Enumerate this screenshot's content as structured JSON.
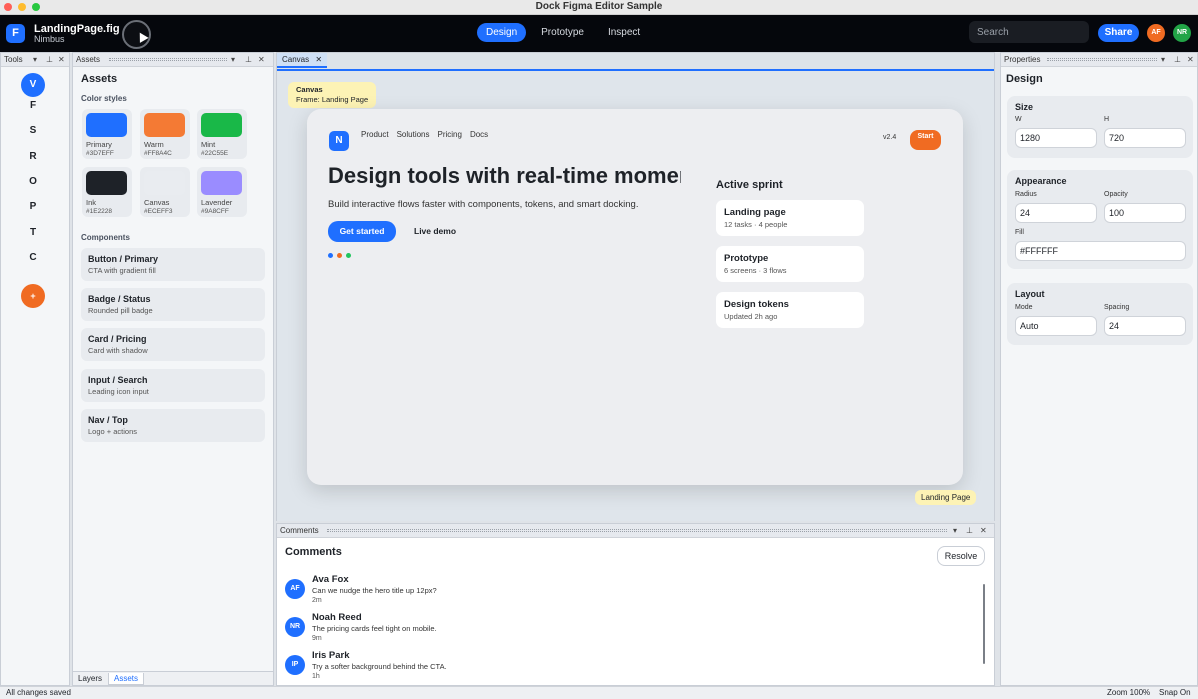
{
  "window": {
    "title": "Dock Figma Editor Sample"
  },
  "app": {
    "logo_letter": "F",
    "file_name": "LandingPage.fig",
    "team": "Nimbus",
    "modes": [
      "Design",
      "Prototype",
      "Inspect"
    ],
    "active_mode": "Design",
    "search_placeholder": "Search",
    "share_label": "Share",
    "avatars": [
      {
        "initials": "AF",
        "color": "#F06B22"
      },
      {
        "initials": "NR",
        "color": "#22A447"
      }
    ]
  },
  "tools_panel": {
    "title": "Tools",
    "tools": [
      "V",
      "F",
      "S",
      "R",
      "O",
      "P",
      "T",
      "C"
    ],
    "active_tool": "V",
    "add_label": "+"
  },
  "assets_panel": {
    "tab_title": "Assets",
    "heading": "Assets",
    "color_styles_label": "Color styles",
    "colors": [
      {
        "name": "Primary",
        "hex": "#3D7EFF"
      },
      {
        "name": "Warm",
        "hex": "#FF8A4C"
      },
      {
        "name": "Mint",
        "hex": "#22C55E"
      },
      {
        "name": "Ink",
        "hex": "#1E2228"
      },
      {
        "name": "Canvas",
        "hex": "#ECEFF3"
      },
      {
        "name": "Lavender",
        "hex": "#9A8CFF"
      }
    ],
    "components_label": "Components",
    "components": [
      {
        "name": "Button / Primary",
        "desc": "CTA with gradient fill"
      },
      {
        "name": "Badge / Status",
        "desc": "Rounded pill badge"
      },
      {
        "name": "Card / Pricing",
        "desc": "Card with shadow"
      },
      {
        "name": "Input / Search",
        "desc": "Leading icon input"
      },
      {
        "name": "Nav / Top",
        "desc": "Logo + actions"
      }
    ],
    "bottom_tabs": [
      "Layers",
      "Assets"
    ],
    "active_bottom_tab": "Assets"
  },
  "canvas": {
    "tab_label": "Canvas",
    "tag_title": "Canvas",
    "tag_subtitle": "Frame: Landing Page",
    "frame": {
      "logo_letter": "N",
      "nav": [
        "Product",
        "Solutions",
        "Pricing",
        "Docs"
      ],
      "version": "v2.4",
      "start_label": "Start",
      "hero_title": "Design tools with real-time momentum",
      "hero_subtitle": "Build interactive flows faster with components, tokens, and smart docking.",
      "primary_cta": "Get started",
      "secondary_cta": "Live demo",
      "dot_colors": [
        "#1F6FFF",
        "#F06B22",
        "#22C55E"
      ],
      "sprint_title": "Active sprint",
      "sprint_items": [
        {
          "name": "Landing page",
          "meta": "12 tasks · 4 people"
        },
        {
          "name": "Prototype",
          "meta": "6 screens · 3 flows"
        },
        {
          "name": "Design tokens",
          "meta": "Updated 2h ago"
        }
      ]
    },
    "frame_label": "Landing Page"
  },
  "comments_panel": {
    "tab_title": "Comments",
    "heading": "Comments",
    "resolve_label": "Resolve",
    "items": [
      {
        "initials": "AF",
        "name": "Ava Fox",
        "text": "Can we nudge the hero title up 12px?",
        "time": "2m"
      },
      {
        "initials": "NR",
        "name": "Noah Reed",
        "text": "The pricing cards feel tight on mobile.",
        "time": "9m"
      },
      {
        "initials": "IP",
        "name": "Iris Park",
        "text": "Try a softer background behind the CTA.",
        "time": "1h"
      }
    ]
  },
  "properties_panel": {
    "tab_title": "Properties",
    "heading": "Design",
    "size": {
      "title": "Size",
      "w_label": "W",
      "w_value": "1280",
      "h_label": "H",
      "h_value": "720"
    },
    "appearance": {
      "title": "Appearance",
      "radius_label": "Radius",
      "radius_value": "24",
      "opacity_label": "Opacity",
      "opacity_value": "100",
      "fill_label": "Fill",
      "fill_value": "#FFFFFF"
    },
    "layout": {
      "title": "Layout",
      "mode_label": "Mode",
      "mode_value": "Auto",
      "spacing_label": "Spacing",
      "spacing_value": "24"
    }
  },
  "status": {
    "left": "All changes saved",
    "zoom": "Zoom 100%",
    "snap": "Snap On"
  }
}
